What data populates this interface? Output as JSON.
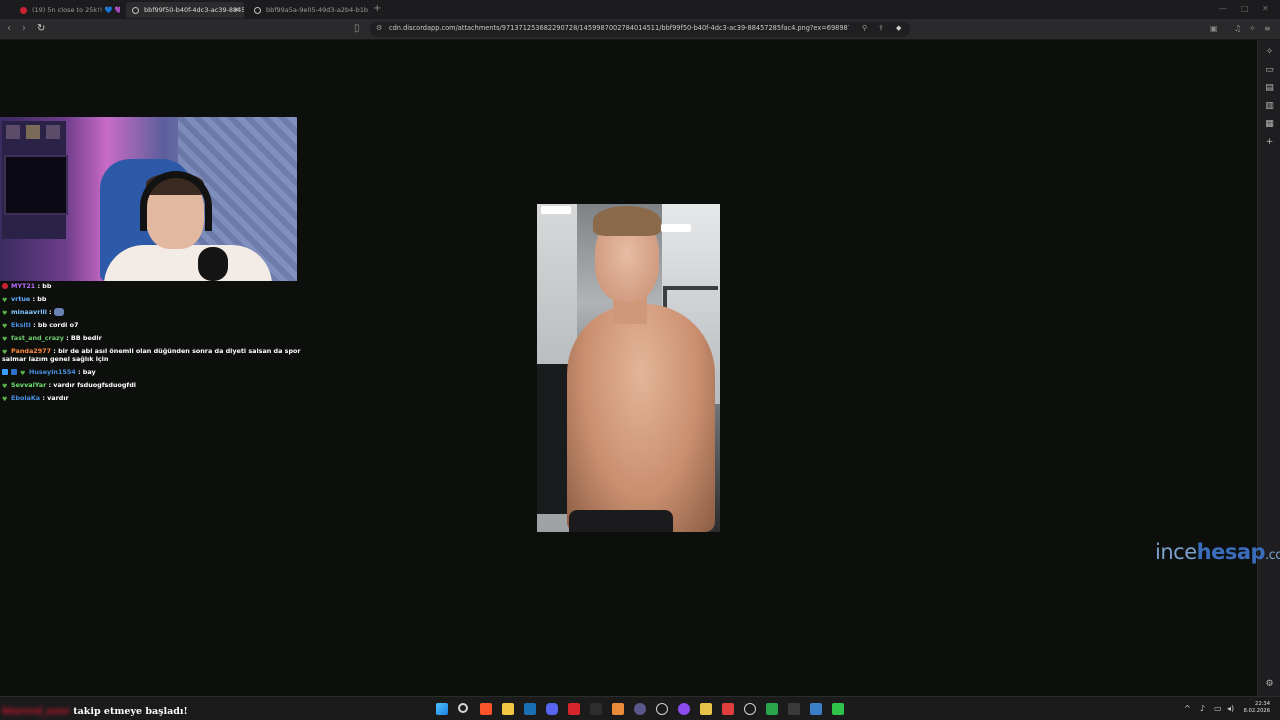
{
  "browser": {
    "tabs": [
      {
        "label": "(19) 5n close to 25k!! 💙 💜 #rocket#...",
        "active": false,
        "favicon_color": "#cc2233"
      },
      {
        "label": "bbf99f50-b40f-4dc3-ac39-8845...",
        "active": true,
        "favicon_color": "#bfbfbf",
        "close": "×"
      },
      {
        "label": "bbf99a5a-9e05-49d3-a2b4-b1b1735...",
        "active": false,
        "favicon_color": "#bfbfbf"
      }
    ],
    "new_tab": "+",
    "url": "cdn.discordapp.com/attachments/971371253682290728/1459987002784014511/bbf99f50-b40f-4dc3-ac39-88457285fac4.png?ex=698987ad&is=69...",
    "window_controls": [
      "—",
      "□",
      "✕"
    ]
  },
  "chat": {
    "messages": [
      {
        "user": "MYT21",
        "text": ": bb",
        "color": "#b86bff",
        "badge_color": "#cc2233"
      },
      {
        "user": "vrtue",
        "text": ": bb",
        "color": "#5fb0ff",
        "badge_color": "#5ab54a"
      },
      {
        "user": "minaavrill",
        "text": ":",
        "color": "#7fc6ff",
        "badge_color": "#5ab54a",
        "emote": true
      },
      {
        "user": "Eksiti",
        "text": ": bb cordi o7",
        "color": "#4a90e2",
        "badge_color": "#5ab54a"
      },
      {
        "user": "fast_and_crazy",
        "text": ": BB bedir",
        "color": "#6fd16f",
        "badge_color": "#5ab54a"
      },
      {
        "user": "Panda2977",
        "text": ": bir de abi asıl önemli olan düğünden sonra da diyeti salsan da spor salmar lazım genel sağlık için",
        "color": "#ff8a3d",
        "badge_color": "#5ab54a"
      },
      {
        "user": "Huseyin1554",
        "text": ": bay",
        "color": "#4a90e2",
        "badge_color": "#3aa0ff"
      },
      {
        "user": "SevvalYar",
        "text": ": vardır fsduogfsduogfdi",
        "color": "#6fe06f",
        "badge_color": "#5ab54a"
      },
      {
        "user": "EbolaKa",
        "text": ": vardır",
        "color": "#4a90e2",
        "badge_color": "#5ab54a"
      }
    ]
  },
  "watermark": {
    "part1": "ince",
    "part2": "hesap",
    "part3": ".com"
  },
  "alert": {
    "user": "blurred_user",
    "text": "takip etmeye başladı!"
  },
  "clock": {
    "time": "22:34",
    "date": "8.02.2026"
  }
}
